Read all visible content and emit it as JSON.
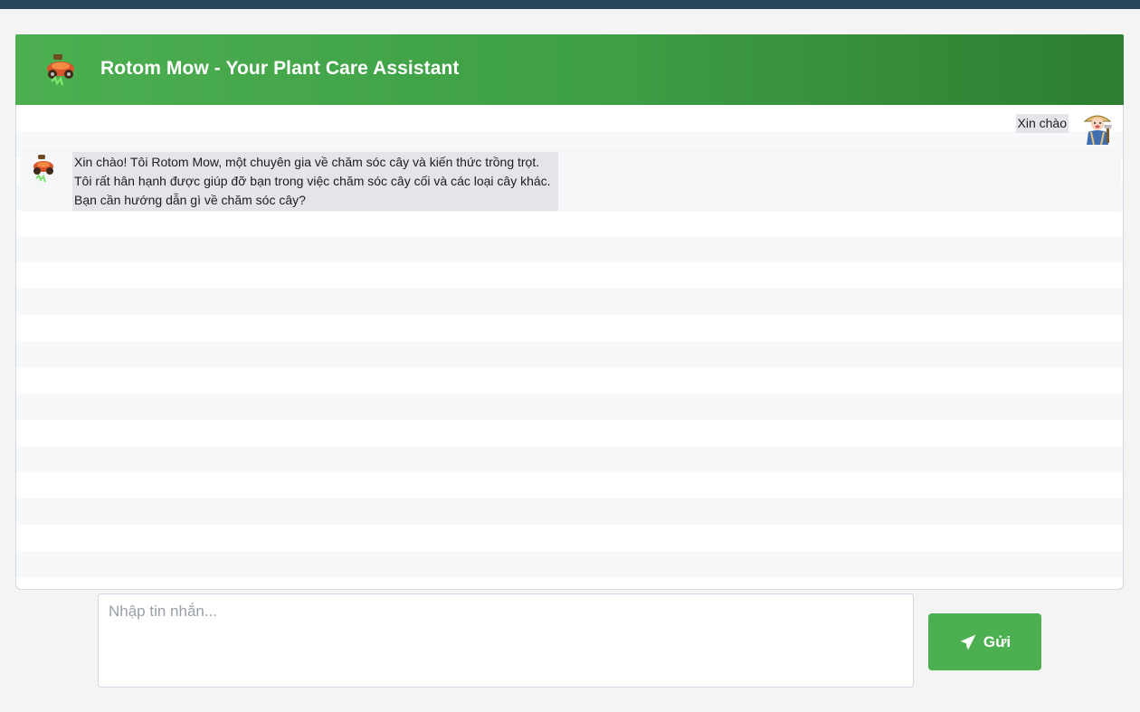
{
  "header": {
    "title": "Rotom Mow - Your Plant Care Assistant",
    "logo_icon": "lawnmower-icon"
  },
  "chat": {
    "messages": [
      {
        "role": "user",
        "avatar_icon": "farmer-avatar-icon",
        "text": "Xin chào"
      },
      {
        "role": "bot",
        "avatar_icon": "lawnmower-icon",
        "lines": [
          "Xin chào! Tôi Rotom Mow, một chuyên gia về chăm sóc cây và kiến thức trồng trọt.",
          "Tôi rất hân hạnh được giúp đỡ bạn trong việc chăm sóc cây cối và các loại cây khác.",
          "Bạn cần hướng dẫn gì về chăm sóc cây?"
        ]
      }
    ]
  },
  "composer": {
    "placeholder": "Nhập tin nhắn...",
    "value": "",
    "send_label": "Gửi",
    "send_icon": "paper-plane-icon"
  },
  "colors": {
    "top_bar": "#25495a",
    "header_start": "#4caf50",
    "header_end": "#2e7d32",
    "send_button": "#4caf50",
    "message_bubble": "#e4e4e9"
  }
}
